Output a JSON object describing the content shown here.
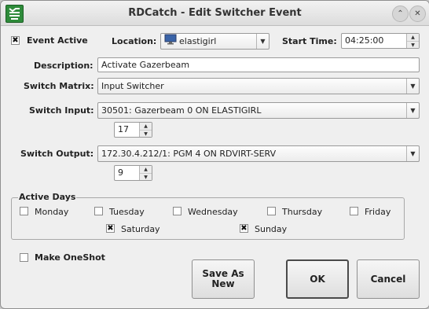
{
  "window": {
    "title": "RDCatch - Edit Switcher Event"
  },
  "event_active": {
    "label": "Event Active",
    "checked": true
  },
  "location": {
    "label": "Location:",
    "value": "elastigirl",
    "icon": "monitor-icon"
  },
  "start_time": {
    "label": "Start Time:",
    "value": "04:25:00"
  },
  "description": {
    "label": "Description:",
    "value": "Activate Gazerbeam"
  },
  "switch_matrix": {
    "label": "Switch Matrix:",
    "value": "Input Switcher"
  },
  "switch_input": {
    "label": "Switch Input:",
    "value": "30501: Gazerbeam 0 ON ELASTIGIRL",
    "number": "17"
  },
  "switch_output": {
    "label": "Switch Output:",
    "value": "172.30.4.212/1: PGM 4 ON RDVIRT-SERV",
    "number": "9"
  },
  "active_days": {
    "title": "Active Days",
    "days": [
      {
        "label": "Monday",
        "checked": false
      },
      {
        "label": "Tuesday",
        "checked": false
      },
      {
        "label": "Wednesday",
        "checked": false
      },
      {
        "label": "Thursday",
        "checked": false
      },
      {
        "label": "Friday",
        "checked": false
      },
      {
        "label": "Saturday",
        "checked": true
      },
      {
        "label": "Sunday",
        "checked": true
      }
    ]
  },
  "make_oneshot": {
    "label": "Make OneShot",
    "checked": false
  },
  "buttons": {
    "save_as_new": "Save As\nNew",
    "ok": "OK",
    "cancel": "Cancel"
  },
  "check_mark": "✖",
  "colors": {
    "icon_green": "#2e8b3a"
  }
}
